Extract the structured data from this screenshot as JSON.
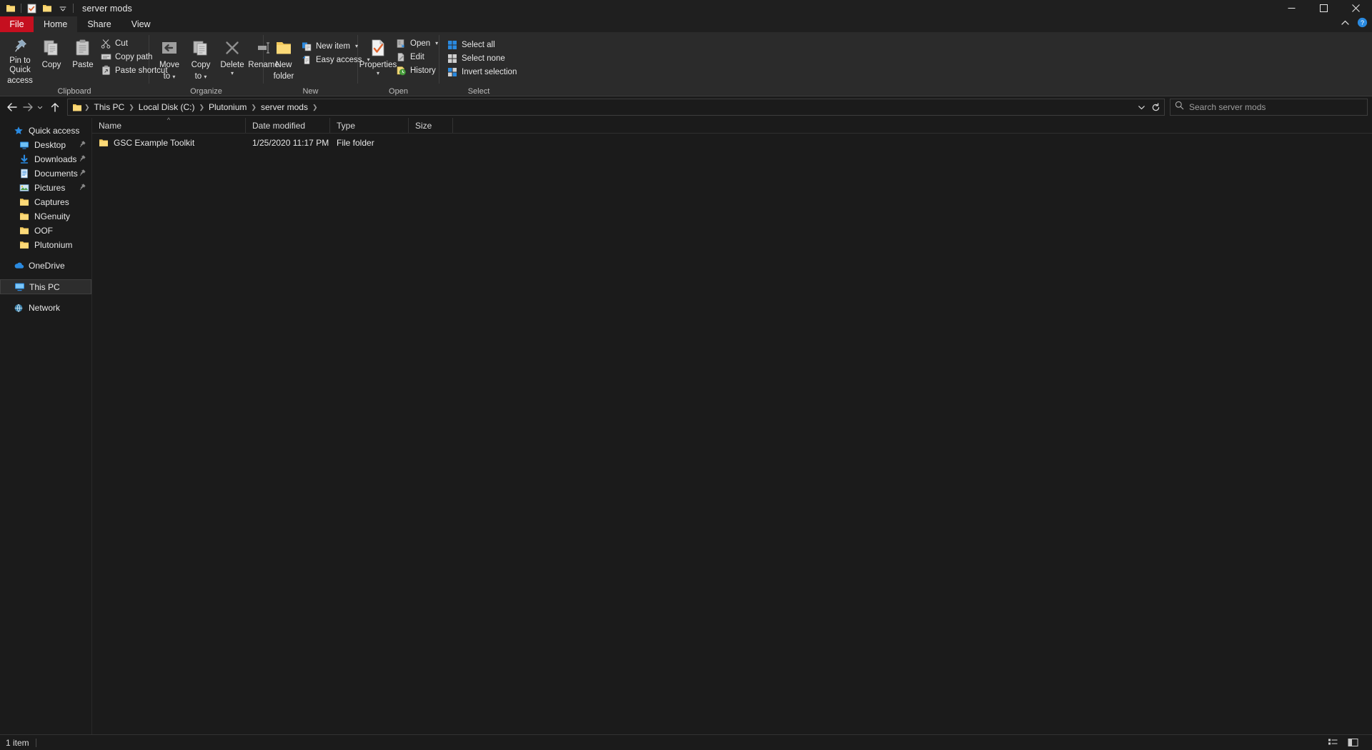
{
  "window": {
    "title": "server mods",
    "quick_access_toolbar": [
      {
        "name": "folder-icon",
        "label": "Folder"
      },
      {
        "name": "properties-icon",
        "label": "Properties"
      },
      {
        "name": "new-folder-icon",
        "label": "New folder"
      },
      {
        "name": "customize-qat-chevron-icon",
        "label": "Customize Quick Access Toolbar"
      }
    ],
    "controls": {
      "minimize": "Minimize",
      "maximize": "Maximize",
      "close": "Close"
    }
  },
  "tabs": [
    {
      "label": "File",
      "active": false,
      "style": "file"
    },
    {
      "label": "Home",
      "active": true,
      "style": "normal"
    },
    {
      "label": "Share",
      "active": false,
      "style": "normal"
    },
    {
      "label": "View",
      "active": false,
      "style": "normal"
    }
  ],
  "tabstrip_right": {
    "collapse_ribbon": "collapse-ribbon-icon",
    "help": "help-icon"
  },
  "ribbon": {
    "groups": [
      {
        "name": "Clipboard",
        "large": [
          {
            "label_line1": "Pin to Quick",
            "label_line2": "access",
            "icon": "pin-icon"
          },
          {
            "label_line1": "Copy",
            "label_line2": "",
            "icon": "copy-icon"
          },
          {
            "label_line1": "Paste",
            "label_line2": "",
            "icon": "paste-icon"
          }
        ],
        "small": [
          {
            "label": "Cut",
            "icon": "scissors-icon",
            "caret": false
          },
          {
            "label": "Copy path",
            "icon": "copy-path-icon",
            "caret": false
          },
          {
            "label": "Paste shortcut",
            "icon": "paste-shortcut-icon",
            "caret": false
          }
        ]
      },
      {
        "name": "Organize",
        "large": [
          {
            "label_line1": "Move",
            "label_line2": "to",
            "icon": "move-to-icon",
            "caret": true
          },
          {
            "label_line1": "Copy",
            "label_line2": "to",
            "icon": "copy-to-icon",
            "caret": true
          },
          {
            "label_line1": "Delete",
            "label_line2": "",
            "icon": "delete-icon",
            "caret": true
          },
          {
            "label_line1": "Rename",
            "label_line2": "",
            "icon": "rename-icon",
            "caret": false
          }
        ],
        "small": []
      },
      {
        "name": "New",
        "large": [
          {
            "label_line1": "New",
            "label_line2": "folder",
            "icon": "new-folder-icon",
            "caret": false
          }
        ],
        "small": [
          {
            "label": "New item",
            "icon": "new-item-icon",
            "caret": true
          },
          {
            "label": "Easy access",
            "icon": "easy-access-icon",
            "caret": true
          }
        ]
      },
      {
        "name": "Open",
        "large": [
          {
            "label_line1": "Properties",
            "label_line2": "",
            "icon": "properties-icon",
            "caret": true
          }
        ],
        "small": [
          {
            "label": "Open",
            "icon": "open-icon",
            "caret": true
          },
          {
            "label": "Edit",
            "icon": "edit-icon",
            "caret": false
          },
          {
            "label": "History",
            "icon": "history-icon",
            "caret": false
          }
        ]
      },
      {
        "name": "Select",
        "large": [],
        "small": [
          {
            "label": "Select all",
            "icon": "select-all-icon",
            "caret": false
          },
          {
            "label": "Select none",
            "icon": "select-none-icon",
            "caret": false
          },
          {
            "label": "Invert selection",
            "icon": "invert-selection-icon",
            "caret": false
          }
        ]
      }
    ]
  },
  "address_bar": {
    "back": "back-arrow-icon",
    "forward": "forward-arrow-icon",
    "recent": "recent-locations-chevron-icon",
    "up": "up-arrow-icon",
    "path_icon": "folder-icon",
    "breadcrumbs": [
      "This PC",
      "Local Disk (C:)",
      "Plutonium",
      "server mods"
    ],
    "history_dropdown": "history-dropdown-icon",
    "refresh": "refresh-icon"
  },
  "search": {
    "placeholder": "Search server mods",
    "icon": "search-icon",
    "value": ""
  },
  "nav_pane": {
    "items": [
      {
        "label": "Quick access",
        "icon": "star-icon",
        "level": 1,
        "pinned": false,
        "selected": false
      },
      {
        "label": "Desktop",
        "icon": "desktop-icon",
        "level": 2,
        "pinned": true,
        "selected": false
      },
      {
        "label": "Downloads",
        "icon": "downloads-icon",
        "level": 2,
        "pinned": true,
        "selected": false
      },
      {
        "label": "Documents",
        "icon": "documents-icon",
        "level": 2,
        "pinned": true,
        "selected": false
      },
      {
        "label": "Pictures",
        "icon": "pictures-icon",
        "level": 2,
        "pinned": true,
        "selected": false
      },
      {
        "label": "Captures",
        "icon": "folder-icon",
        "level": 2,
        "pinned": false,
        "selected": false
      },
      {
        "label": "NGenuity",
        "icon": "folder-icon",
        "level": 2,
        "pinned": false,
        "selected": false
      },
      {
        "label": "OOF",
        "icon": "folder-icon",
        "level": 2,
        "pinned": false,
        "selected": false
      },
      {
        "label": "Plutonium",
        "icon": "folder-icon",
        "level": 2,
        "pinned": false,
        "selected": false
      },
      {
        "label": "OneDrive",
        "icon": "onedrive-icon",
        "level": 1,
        "pinned": false,
        "selected": false,
        "gap_before": true
      },
      {
        "label": "This PC",
        "icon": "this-pc-icon",
        "level": 1,
        "pinned": false,
        "selected": true,
        "gap_before": true
      },
      {
        "label": "Network",
        "icon": "network-icon",
        "level": 1,
        "pinned": false,
        "selected": false,
        "gap_before": true
      }
    ]
  },
  "file_list": {
    "columns": [
      {
        "label": "Name",
        "sorted": true,
        "sort_direction": "asc"
      },
      {
        "label": "Date modified",
        "sorted": false
      },
      {
        "label": "Type",
        "sorted": false
      },
      {
        "label": "Size",
        "sorted": false
      }
    ],
    "rows": [
      {
        "name": "GSC Example Toolkit",
        "date_modified": "1/25/2020 11:17 PM",
        "type": "File folder",
        "size": "",
        "icon": "folder-icon"
      }
    ]
  },
  "status_bar": {
    "item_count": "1 item",
    "views": [
      {
        "name": "details-view-button",
        "label": "Details view"
      },
      {
        "name": "large-icons-view-button",
        "label": "Large icons view"
      }
    ]
  },
  "colors": {
    "accent_blue": "#2a8ae0",
    "file_tab_red": "#c50f1f",
    "folder_yellow": "#f7cf5d",
    "background": "#1b1b1b",
    "ribbon_bg": "#2b2b2b"
  }
}
